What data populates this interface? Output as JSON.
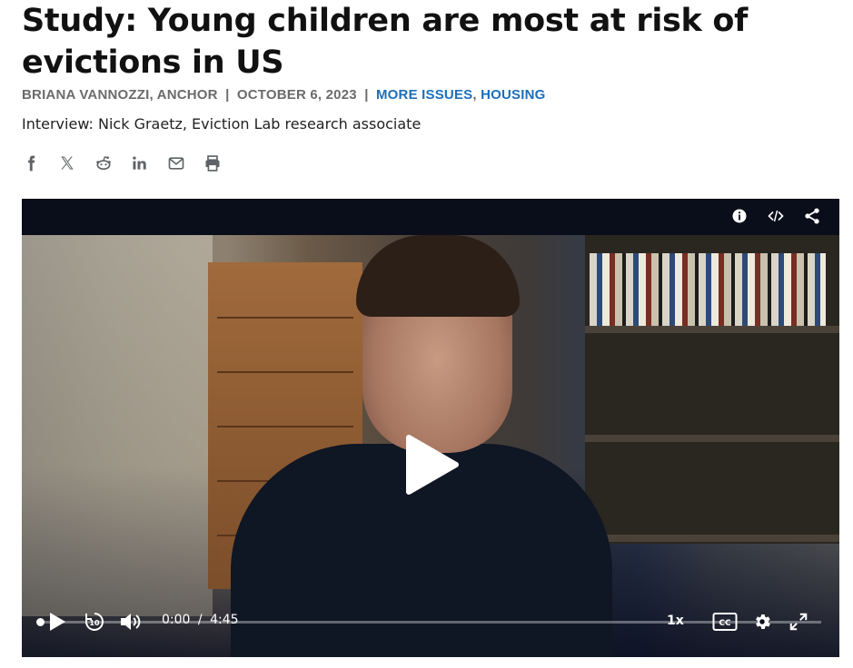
{
  "article": {
    "title": "Study: Young children are most at risk of evictions in US",
    "byline": {
      "author": "BRIANA VANNOZZI, ANCHOR",
      "date": "OCTOBER 6, 2023",
      "separator": "|",
      "category_primary": "MORE ISSUES",
      "category_comma": ",",
      "category_secondary": "HOUSING"
    },
    "subtitle": "Interview: Nick Graetz, Eviction Lab research associate"
  },
  "share": {
    "icons": [
      "facebook-icon",
      "x-icon",
      "reddit-icon",
      "linkedin-icon",
      "email-icon",
      "print-icon"
    ]
  },
  "player": {
    "top_icons": [
      "info-icon",
      "embed-icon",
      "share-icon"
    ],
    "time_current": "0:00",
    "time_separator": "/",
    "time_total": "4:45",
    "progress_fraction": 0.0,
    "speed": "1x",
    "cc_label": "CC",
    "rewind_seconds": "10"
  },
  "colors": {
    "link": "#1c6fb8",
    "byline_gray": "#6b6b6b",
    "player_bg": "#0a0d1a"
  }
}
